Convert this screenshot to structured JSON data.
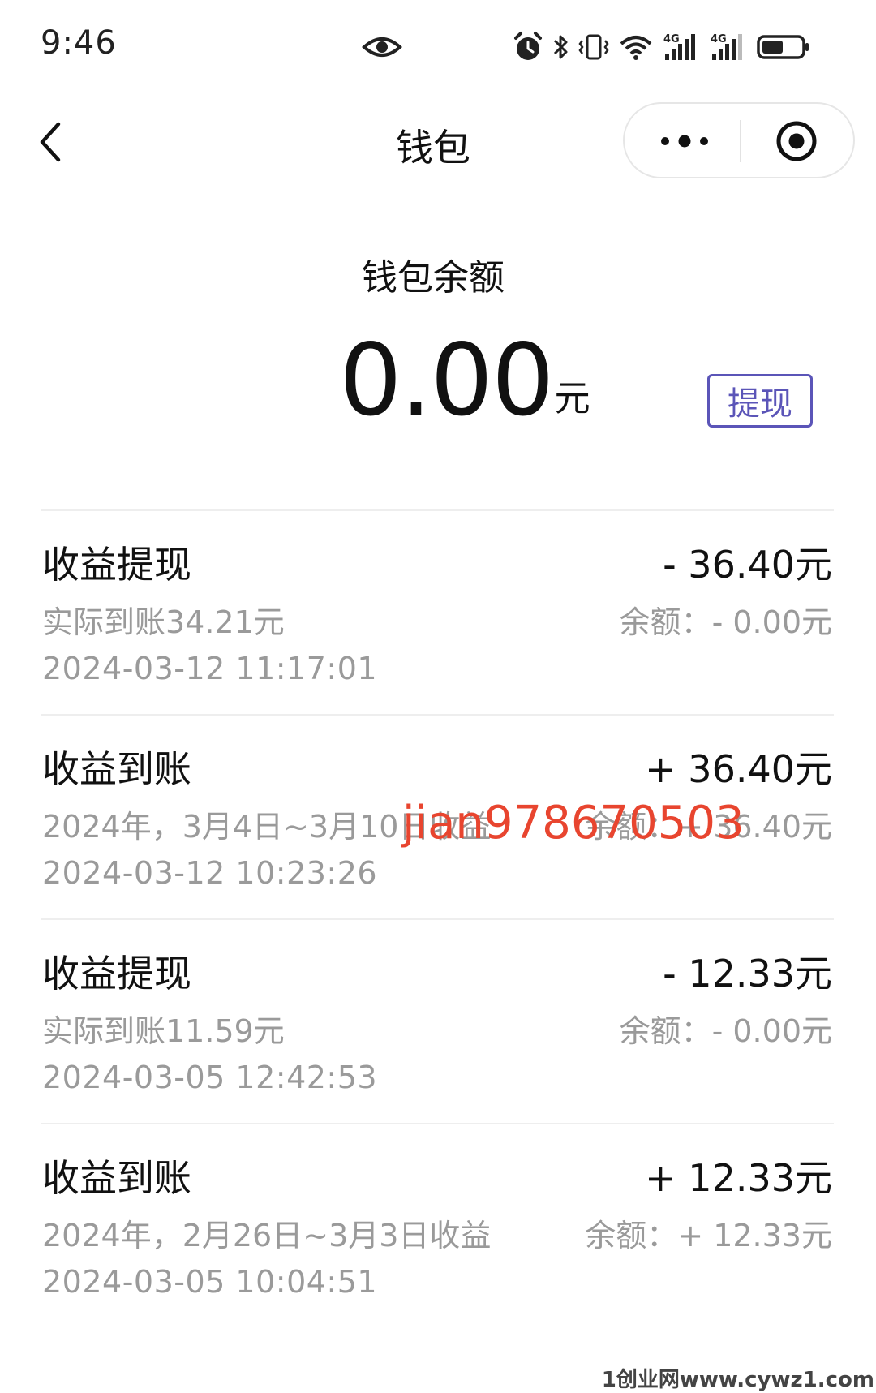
{
  "status_bar": {
    "time": "9:46",
    "icons": [
      "eye-icon",
      "alarm-icon",
      "bluetooth-icon",
      "vibrate-icon",
      "wifi-icon",
      "signal-4g-icon",
      "signal-4g-icon",
      "battery-icon"
    ],
    "signal_label_1": "4G",
    "signal_label_2": "4G",
    "battery_level": 0.55
  },
  "nav": {
    "title": "钱包",
    "back_icon": "chevron-left-icon",
    "more_icon": "more-dots-icon",
    "close_icon": "target-icon"
  },
  "balance": {
    "label": "钱包余额",
    "amount": "0.00",
    "unit": "元",
    "withdraw_label": "提现",
    "accent_color": "#5b55b8"
  },
  "records": [
    {
      "title": "收益提现",
      "amount": "- 36.40元",
      "desc": "实际到账34.21元",
      "balance": "余额：- 0.00元",
      "time": "2024-03-12 11:17:01"
    },
    {
      "title": "收益到账",
      "amount": "+ 36.40元",
      "desc": "2024年，3月4日~3月10日收益",
      "balance": "余额：+ 36.40元",
      "time": "2024-03-12 10:23:26"
    },
    {
      "title": "收益提现",
      "amount": "- 12.33元",
      "desc": "实际到账11.59元",
      "balance": "余额：- 0.00元",
      "time": "2024-03-05 12:42:53"
    },
    {
      "title": "收益到账",
      "amount": "+ 12.33元",
      "desc": "2024年，2月26日~3月3日收益",
      "balance": "余额：+ 12.33元",
      "time": "2024-03-05 10:04:51"
    }
  ],
  "watermarks": {
    "overlay_text": "jian978670503",
    "overlay_color": "#e8452f",
    "site_text": "1创业网www.cywz1.com"
  }
}
